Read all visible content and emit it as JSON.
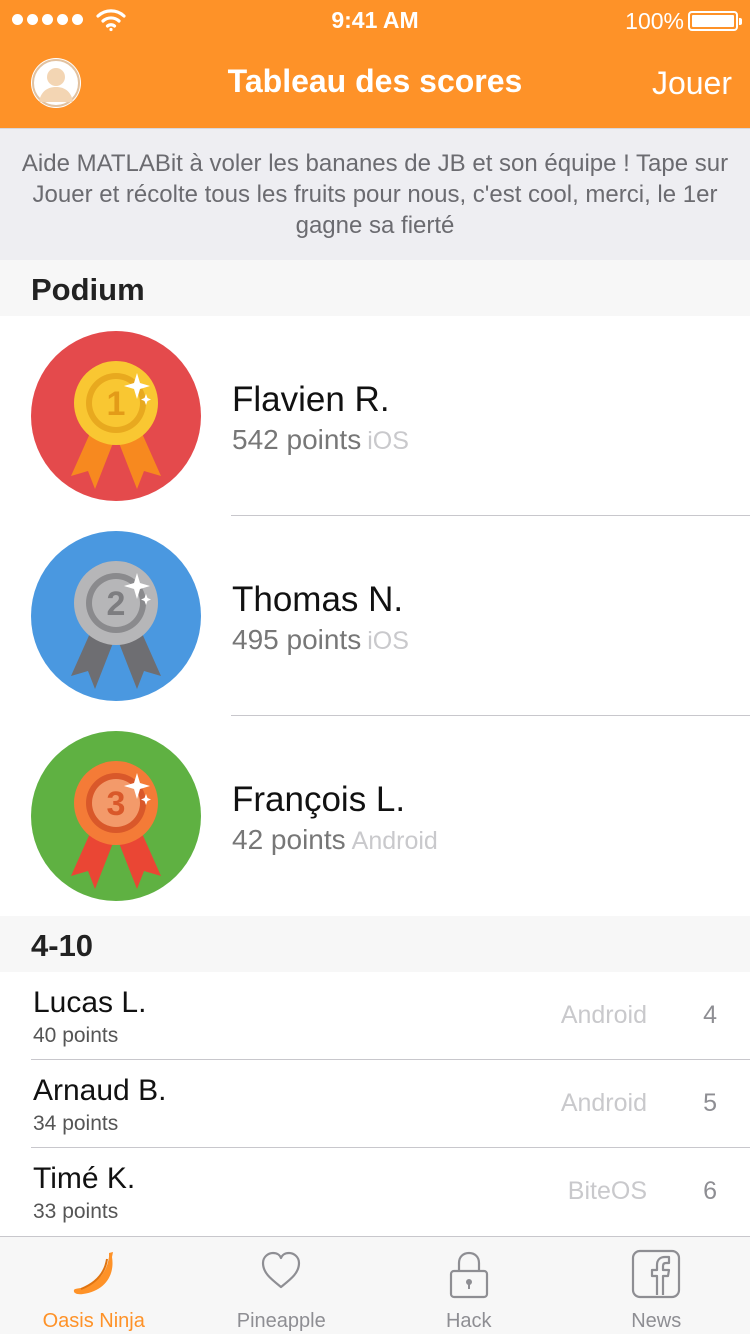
{
  "status_bar": {
    "time": "9:41 AM",
    "battery": "100%"
  },
  "nav": {
    "title": "Tableau des scores",
    "action": "Jouer"
  },
  "intro": "Aide MATLABit à voler les bananes de JB et son équipe ! Tape sur Jouer et récolte tous les fruits pour nous, c'est cool, merci, le 1er gagne sa fierté",
  "sections": {
    "podium": "Podium",
    "rest": "4-10"
  },
  "podium": [
    {
      "name": "Flavien R.",
      "points": "542 points",
      "platform": "iOS",
      "rank": "1",
      "circle_color": "#e44a4c",
      "medal_color": "#f9c732",
      "ribbon_color": "#f7891f"
    },
    {
      "name": "Thomas N.",
      "points": "495 points",
      "platform": "iOS",
      "rank": "2",
      "circle_color": "#4a98e0",
      "medal_color": "#b6b6b8",
      "ribbon_color": "#6e6e72"
    },
    {
      "name": "François L.",
      "points": "42 points",
      "platform": "Android",
      "rank": "3",
      "circle_color": "#5fb142",
      "medal_color": "#f47b37",
      "ribbon_color": "#ea4634"
    }
  ],
  "ranking": [
    {
      "name": "Lucas L.",
      "points": "40 points",
      "platform": "Android",
      "rank": "4"
    },
    {
      "name": "Arnaud B.",
      "points": "34 points",
      "platform": "Android",
      "rank": "5"
    },
    {
      "name": "Timé K.",
      "points": "33 points",
      "platform": "BiteOS",
      "rank": "6"
    }
  ],
  "tabs": [
    {
      "label": "Oasis Ninja",
      "icon": "banana-icon",
      "active": true
    },
    {
      "label": "Pineapple",
      "icon": "heart-icon",
      "active": false
    },
    {
      "label": "Hack",
      "icon": "lock-icon",
      "active": false
    },
    {
      "label": "News",
      "icon": "facebook-icon",
      "active": false
    }
  ],
  "colors": {
    "accent": "#fe9228",
    "intro_bg": "#eeeef2",
    "section_bg": "#f7f7f7"
  }
}
